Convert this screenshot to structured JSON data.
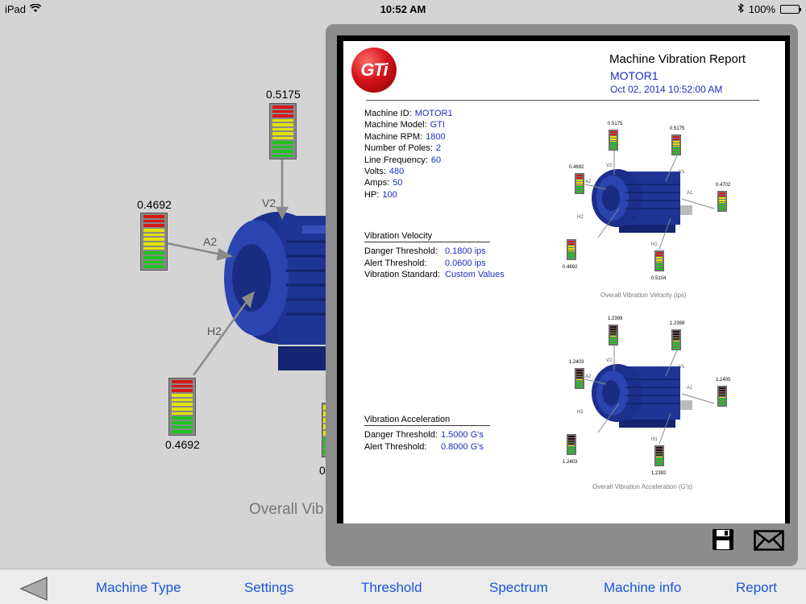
{
  "status_bar": {
    "carrier": "iPad",
    "time": "10:52 AM",
    "battery": "100%"
  },
  "background_view": {
    "meters": [
      {
        "id": "V2",
        "label": "V2",
        "value": "0.5175"
      },
      {
        "id": "A2",
        "label": "A2",
        "value": "0.4692"
      },
      {
        "id": "H2",
        "label": "H2",
        "value": "0.4692"
      },
      {
        "id": "H1",
        "label": "",
        "value": "0"
      }
    ],
    "caption": "Overall Vib"
  },
  "report": {
    "logo_text": "GTi",
    "title": "Machine Vibration Report",
    "machine": "MOTOR1",
    "date": "Oct 02, 2014  10:52:00 AM",
    "machine_info": [
      {
        "label": "Machine ID:",
        "value": "MOTOR1"
      },
      {
        "label": "Machine Model:",
        "value": "GTI"
      },
      {
        "label": "Machine RPM:",
        "value": "1800"
      },
      {
        "label": "Number of Poles:",
        "value": "2"
      },
      {
        "label": "Line Frequency:",
        "value": "60"
      },
      {
        "label": "Volts:",
        "value": "480"
      },
      {
        "label": "Amps:",
        "value": "50"
      },
      {
        "label": "HP:",
        "value": "100"
      }
    ],
    "velocity": {
      "heading": "Vibration Velocity",
      "rows": [
        {
          "label": "Danger Threshold:",
          "value": "0.1800 ips"
        },
        {
          "label": "Alert Threshold:",
          "value": "0.0600 ips"
        },
        {
          "label": "Vibration Standard:",
          "value": "Custom Values"
        }
      ],
      "diagram_caption": "Overall Vibration Velocity (ips)",
      "points": [
        {
          "label": "V2",
          "value": "0.5175"
        },
        {
          "label": "V1",
          "value": "0.5175"
        },
        {
          "label": "A2",
          "value": "0.4692"
        },
        {
          "label": "A1",
          "value": "0.4702"
        },
        {
          "label": "H2",
          "value": "0.4692"
        },
        {
          "label": "H1",
          "value": "0.5104"
        }
      ]
    },
    "acceleration": {
      "heading": "Vibration Acceleration",
      "rows": [
        {
          "label": "Danger Threshold:",
          "value": "1.5000 G's"
        },
        {
          "label": "Alert Threshold:",
          "value": "0.8000 G's"
        }
      ],
      "diagram_caption": "Overall Vibration Acceleration (G's)",
      "points": [
        {
          "label": "V2",
          "value": "1.2399"
        },
        {
          "label": "V1",
          "value": "1.2399"
        },
        {
          "label": "A2",
          "value": "1.2403"
        },
        {
          "label": "A1",
          "value": "1.2405"
        },
        {
          "label": "H2",
          "value": "1.2403"
        },
        {
          "label": "H1",
          "value": "1.2392"
        }
      ]
    }
  },
  "toolbar": {
    "tabs": [
      {
        "label": "Machine Type"
      },
      {
        "label": "Settings"
      },
      {
        "label": "Threshold"
      },
      {
        "label": "Spectrum"
      },
      {
        "label": "Machine info"
      },
      {
        "label": "Report"
      }
    ]
  },
  "colors": {
    "link": "#1a56d6",
    "value_blue": "#1a2ec0",
    "motor_blue": "#1c2f8c",
    "danger": "#d81818",
    "alert": "#e3e300",
    "ok": "#1ec41e"
  }
}
